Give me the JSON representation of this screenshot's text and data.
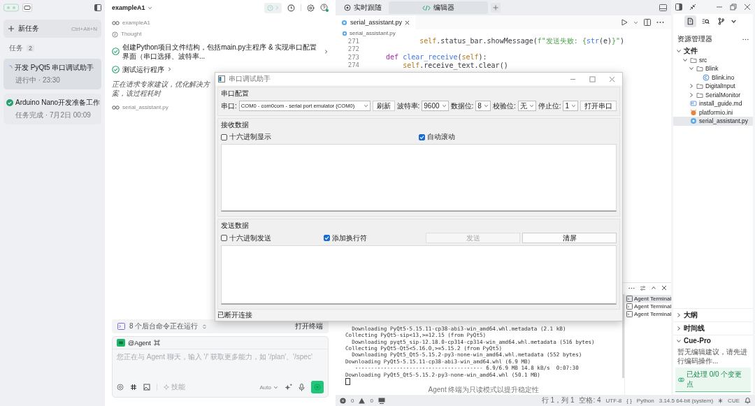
{
  "sidebar": {
    "new_task": {
      "label": "新任务",
      "shortcut": "Ctrl+Alt+N"
    },
    "section": {
      "label": "任务",
      "count": "2"
    },
    "tasks": [
      {
        "title": "开发 PyQt5 串口调试助手",
        "status": "进行中 · 23:30",
        "kind": "running",
        "selected": true
      },
      {
        "title": "Arduino Nano开发准备工作",
        "status": "任务完成 · 7月2日 00:09",
        "kind": "done",
        "selected": false
      }
    ]
  },
  "chat": {
    "project": "exampleA1",
    "steps": [
      {
        "kind": "workspace",
        "text": "exampleA1"
      },
      {
        "kind": "thought",
        "text": "Thought"
      },
      {
        "kind": "done",
        "text": "创建Python项目文件结构，包括main.py主程序 & 实现串口配置界面（串口选择、波特率...",
        "expandable": true
      },
      {
        "kind": "done",
        "text": "测试运行程序",
        "expandable": true
      },
      {
        "kind": "status",
        "text": "正在请求专家建议，优化解决方案，该过程耗时"
      },
      {
        "kind": "file",
        "text": "serial_assistant.py"
      }
    ],
    "background": {
      "text": "8 个后台命令正在运行",
      "action": "打开终端"
    },
    "composer": {
      "agent": "@Agent",
      "placeholder": "您正在与 Agent 聊天，输入 '/' 获取更多能力，如 '/plan'、'/spec'",
      "tool_label": "技能",
      "mode": "Auto"
    }
  },
  "editor": {
    "views": [
      {
        "label": "实时跟随",
        "kind": "follow",
        "selected": false
      },
      {
        "label": "编辑器",
        "kind": "code",
        "selected": true
      }
    ],
    "file_tab": "serial_assistant.py",
    "breadcrumb": "serial_assistant.py",
    "code": [
      {
        "number": "271",
        "tokens": [
          {
            "kind": "self",
            "t": "            self"
          },
          {
            "kind": "plain",
            "t": ".status_bar.showMessage("
          },
          {
            "kind": "str",
            "t": "f\"发送失败: {"
          },
          {
            "kind": "fn",
            "t": "str"
          },
          {
            "kind": "plain",
            "t": "(e)"
          },
          {
            "kind": "str",
            "t": "}\""
          },
          {
            "kind": "plain",
            "t": ")"
          }
        ]
      },
      {
        "number": "272"
      },
      {
        "number": "273",
        "tokens": [
          {
            "kind": "kw",
            "t": "    def"
          },
          {
            "kind": "fn",
            "t": " clear_receive"
          },
          {
            "kind": "plain",
            "t": "("
          },
          {
            "kind": "self",
            "t": "self"
          },
          {
            "kind": "plain",
            "t": "):"
          }
        ]
      },
      {
        "number": "274",
        "tokens": [
          {
            "kind": "self",
            "t": "        self"
          },
          {
            "kind": "plain",
            "t": ".receive_text.clear()"
          }
        ]
      }
    ],
    "terminal": {
      "lines": [
        "  Downloading PyQt5-5.15.11-cp38-abi3-win_amd64.whl.metadata (2.1 kB)",
        "Collecting PyQt5-sip<13,>=12.15 (from PyQt5)",
        "  Downloading pyqt5_sip-12.18.0-cp314-cp314-win_amd64.whl.metadata (516 bytes)",
        "Collecting PyQt5-Qt5<5.16.0,>=5.15.2 (from PyQt5)",
        "  Downloading PyQt5_Qt5-5.15.2-py3-none-win_amd64.whl.metadata (552 bytes)",
        "Downloading PyQt5-5.15.11-cp38-abi3-win_amd64.whl (6.9 MB)",
        "   ---------------------------------------- 6.9/6.9 MB 14.8 kB/s  0:07:30",
        "Downloading PyQt5_Qt5-5.15.2-py3-none-win_amd64.whl (50.1 MB)"
      ],
      "note": "Agent 终端为只读模式以提升稳定性",
      "sessions": [
        {
          "label": "Agent Terminal",
          "selected": true
        },
        {
          "label": "Agent Terminal",
          "selected": false
        },
        {
          "label": "Agent Terminal",
          "selected": false
        }
      ]
    }
  },
  "explorer": {
    "tabs": [
      {
        "kind": "files",
        "selected": true
      },
      {
        "kind": "search",
        "selected": false
      },
      {
        "kind": "git",
        "selected": false
      }
    ],
    "title": "资源管理器",
    "tree": [
      {
        "label": "文件",
        "kind": "section",
        "expanded": true,
        "selected": false,
        "children": [
          {
            "label": "src",
            "kind": "folder",
            "expanded": true,
            "selected": false,
            "children": [
              {
                "label": "Blink",
                "kind": "folder",
                "expanded": true,
                "selected": false,
                "children": [
                  {
                    "label": "Blink.ino",
                    "kind": "ino",
                    "selected": false
                  }
                ]
              },
              {
                "label": "DigitalInput",
                "kind": "folder",
                "expanded": false,
                "selected": false
              },
              {
                "label": "SerialMonitor",
                "kind": "folder",
                "expanded": false,
                "selected": false
              }
            ]
          },
          {
            "label": "install_guide.md",
            "kind": "md",
            "selected": false
          },
          {
            "label": "platformio.ini",
            "kind": "ini",
            "selected": false
          },
          {
            "label": "serial_assistant.py",
            "kind": "py",
            "selected": true
          }
        ]
      }
    ],
    "panels": [
      {
        "label": "大纲",
        "expanded": false
      },
      {
        "label": "时间线",
        "expanded": false
      },
      {
        "label": "Cue-Pro",
        "expanded": true,
        "text": "暂无编辑建议，请先进行编码操作...",
        "summary": "已处理 0/0 个变更点"
      }
    ]
  },
  "status_bar": {
    "errors": "0",
    "warnings": "0",
    "position": "行 1，列 1",
    "indent": "空格: 4",
    "encoding": "UTF-8",
    "braces": "{ }",
    "language": "Python",
    "interpreter": "3.14.5 64-bit (system)",
    "extension": "CUE"
  },
  "dialog": {
    "title": "串口调试助手",
    "config": {
      "title": "串口配置",
      "port_label": "串口:",
      "port": "COM0 - com0com - serial port emulator (COM0)",
      "refresh": "刷新",
      "baud_label": "波特率:",
      "baud": "9600",
      "data_label": "数据位:",
      "data": "8",
      "parity_label": "校验位:",
      "parity": "无",
      "stop_label": "停止位:",
      "stop": "1",
      "open": "打开串口"
    },
    "receive": {
      "title": "接收数据",
      "options": [
        {
          "label": "十六进制显示",
          "checked": false
        },
        {
          "label": "自动滚动",
          "checked": true
        }
      ]
    },
    "send": {
      "title": "发送数据",
      "options": [
        {
          "label": "十六进制发送",
          "checked": false
        },
        {
          "label": "添加换行符",
          "checked": true
        }
      ],
      "buttons": [
        {
          "label": "发送",
          "disabled": true
        },
        {
          "label": "清屏",
          "disabled": false
        }
      ]
    },
    "status": "已断开连接"
  }
}
